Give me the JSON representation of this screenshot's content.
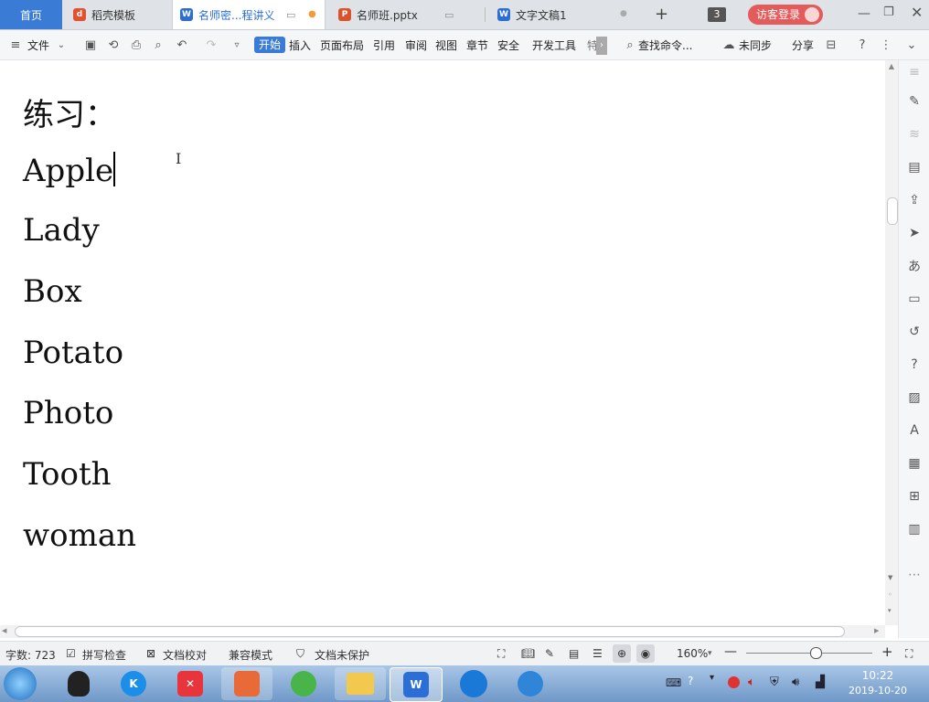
{
  "tabs": [
    {
      "label": "首页",
      "active_home": true
    },
    {
      "label": "稻壳模板"
    },
    {
      "label": "名师密...程讲义",
      "active": true
    },
    {
      "label": "名师班.pptx"
    },
    {
      "label": "文字文稿1"
    }
  ],
  "tab_count": "3",
  "login_label": "访客登录",
  "toolbar": {
    "file_menu": "文件",
    "items": [
      "开始",
      "插入",
      "页面布局",
      "引用",
      "审阅",
      "视图",
      "章节",
      "安全",
      "开发工具",
      "特"
    ],
    "search": "查找命令...",
    "sync": "未同步",
    "share": "分享"
  },
  "document": {
    "lines": [
      "练习：",
      "Apple",
      "Lady",
      "Box",
      "Potato",
      "Photo",
      "Tooth",
      "woman"
    ]
  },
  "status": {
    "word_count": "字数: 723",
    "spell_check": "拼写检查",
    "doc_proof": "文档校对",
    "compat_mode": "兼容模式",
    "protection": "文档未保护",
    "zoom": "160%"
  },
  "clock": {
    "time": "10:22",
    "date": "2019-10-20"
  },
  "colors": {
    "accent": "#3a7bd5",
    "login_red": "#e35b5b"
  }
}
